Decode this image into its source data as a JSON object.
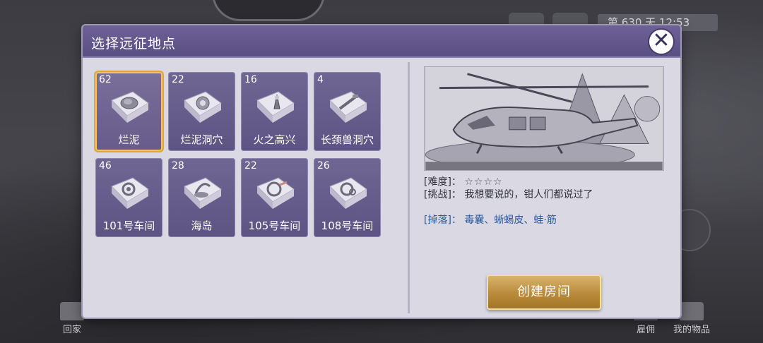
{
  "background": {
    "status_text": "第 630 天  12:53",
    "bottom_left_label": "回家",
    "bottom_right_labels": [
      "雇佣",
      "我的物品"
    ]
  },
  "dialog": {
    "title": "选择远征地点",
    "close_symbol": "✕",
    "locations": [
      {
        "count": "62",
        "name": "烂泥",
        "selected": true
      },
      {
        "count": "22",
        "name": "烂泥洞穴",
        "selected": false
      },
      {
        "count": "16",
        "name": "火之高兴",
        "selected": false
      },
      {
        "count": "4",
        "name": "长颈兽洞穴",
        "selected": false
      },
      {
        "count": "46",
        "name": "101号车间",
        "selected": false
      },
      {
        "count": "28",
        "name": "海岛",
        "selected": false
      },
      {
        "count": "22",
        "name": "105号车间",
        "selected": false
      },
      {
        "count": "26",
        "name": "108号车间",
        "selected": false
      }
    ],
    "detail": {
      "difficulty_label": "[难度]：",
      "difficulty_stars": "☆☆☆☆",
      "challenge_label": "[挑战]：",
      "challenge_text": "我想要说的，钳人们都说过了",
      "drops_label": "[掉落]：",
      "drops_text": "毒囊、蜥蜴皮、蛙·筋"
    },
    "create_button": "创建房间"
  },
  "colors": {
    "header": "#5a4f82",
    "card": "#6a6190",
    "selected_border": "#e2a33c",
    "button_gold": "#b98a3a",
    "drops_blue": "#2b5a9a"
  }
}
